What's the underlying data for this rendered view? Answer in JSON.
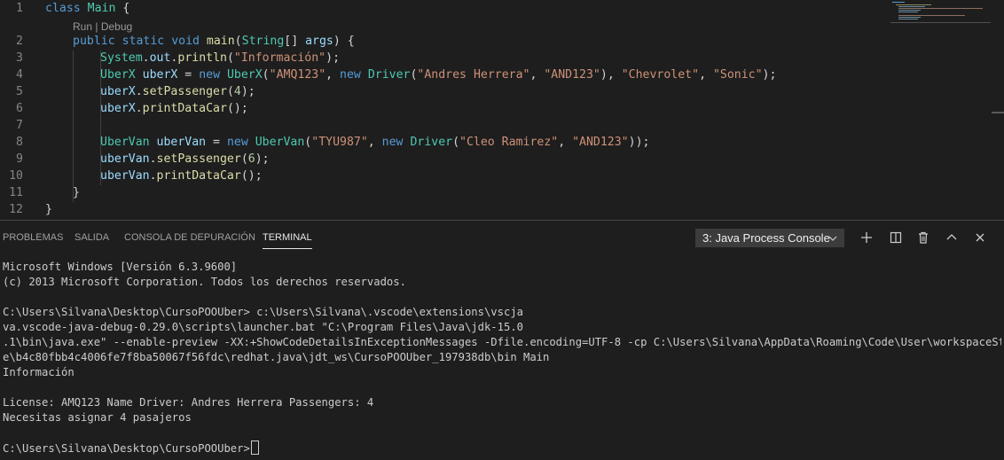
{
  "editor": {
    "codelens": {
      "run": "Run",
      "sep": " | ",
      "debug": "Debug"
    },
    "line_numbers": [
      "1",
      "2",
      "3",
      "4",
      "5",
      "6",
      "7",
      "8",
      "9",
      "10",
      "11",
      "12"
    ],
    "lines": {
      "l1": {
        "kw": "class",
        "name": "Main",
        "rest": " {"
      },
      "l2": {
        "kw1": "public",
        "kw2": "static",
        "kw3": "void",
        "fn": "main",
        "p1": "(",
        "ty": "String",
        "p2": "[] ",
        "var": "args",
        "p3": ") {"
      },
      "l3": {
        "ty": "System",
        "dot1": ".",
        "field": "out",
        "dot2": ".",
        "fn": "println",
        "p1": "(",
        "str": "\"Información\"",
        "p2": ");"
      },
      "l4": {
        "ty1": "UberX",
        "var": "uberX",
        "eq": " = ",
        "kw1": "new",
        "ty2": "UberX",
        "p1": "(",
        "s1": "\"AMQ123\"",
        "c1": ", ",
        "kw2": "new",
        "ty3": "Driver",
        "p2": "(",
        "s2": "\"Andres Herrera\"",
        "c2": ", ",
        "s3": "\"AND123\"",
        "c3": "), ",
        "s4": "\"Chevrolet\"",
        "c4": ", ",
        "s5": "\"Sonic\"",
        "end": ");"
      },
      "l5": {
        "var": "uberX",
        "dot": ".",
        "fn": "setPassenger",
        "p1": "(",
        "num": "4",
        "p2": ");"
      },
      "l6": {
        "var": "uberX",
        "dot": ".",
        "fn": "printDataCar",
        "p": "();"
      },
      "l8": {
        "ty1": "UberVan",
        "var": "uberVan",
        "eq": " = ",
        "kw1": "new",
        "ty2": "UberVan",
        "p1": "(",
        "s1": "\"TYU987\"",
        "c1": ", ",
        "kw2": "new",
        "ty3": "Driver",
        "p2": "(",
        "s2": "\"Cleo Ramirez\"",
        "c2": ", ",
        "s3": "\"AND123\"",
        "end": "));"
      },
      "l9": {
        "var": "uberVan",
        "dot": ".",
        "fn": "setPassenger",
        "p1": "(",
        "num": "6",
        "p2": ");"
      },
      "l10": {
        "var": "uberVan",
        "dot": ".",
        "fn": "printDataCar",
        "p": "();"
      },
      "l11": {
        "text": "}"
      },
      "l12": {
        "text": "}"
      }
    }
  },
  "panel": {
    "tabs": [
      {
        "label": "PROBLEMAS"
      },
      {
        "label": "SALIDA"
      },
      {
        "label": "CONSOLA DE DEPURACIÓN"
      },
      {
        "label": "TERMINAL"
      }
    ],
    "active_tab": "TERMINAL",
    "terminal_select": {
      "value": "3: Java Process Console"
    },
    "actions": [
      "plus-icon",
      "split-icon",
      "trash-icon",
      "chevron-up-icon",
      "close-icon"
    ]
  },
  "terminal": {
    "lines": [
      "Microsoft Windows [Versión 6.3.9600]",
      "(c) 2013 Microsoft Corporation. Todos los derechos reservados.",
      "",
      "C:\\Users\\Silvana\\Desktop\\CursoPOOUber> c:\\Users\\Silvana\\.vscode\\extensions\\vscja",
      "va.vscode-java-debug-0.29.0\\scripts\\launcher.bat \"C:\\Program Files\\Java\\jdk-15.0",
      ".1\\bin\\java.exe\" --enable-preview -XX:+ShowCodeDetailsInExceptionMessages -Dfile.encoding=UTF-8 -cp C:\\Users\\Silvana\\AppData\\Roaming\\Code\\User\\workspaceStorag",
      "e\\b4c80fbb4c4006fe7f8ba50067f56fdc\\redhat.java\\jdt_ws\\CursoPOOUber_197938db\\bin Main",
      "Información",
      "",
      "License: AMQ123 Name Driver: Andres Herrera Passengers: 4",
      "Necesitas asignar 4 pasajeros",
      ""
    ],
    "prompt": "C:\\Users\\Silvana\\Desktop\\CursoPOOUber>"
  },
  "colors": {
    "background": "#1e1e1e",
    "keyword": "#569cd6",
    "type": "#4ec9b0",
    "function": "#dcdcaa",
    "string": "#ce9178",
    "number": "#b5cea8",
    "variable": "#9cdcfe",
    "line_number": "#858585",
    "terminal_text": "#cccccc"
  }
}
